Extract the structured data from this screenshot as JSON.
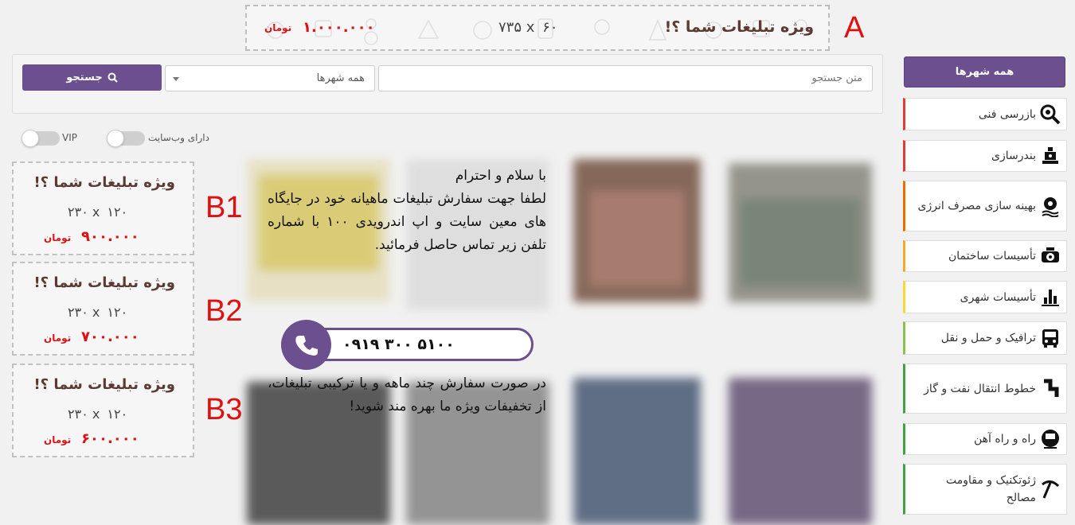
{
  "top_banner": {
    "title": "ویژه تبلیغات شما ؟!",
    "dims": "۷۳۵ x ۶۰",
    "price": "۱.۰۰۰.۰۰۰",
    "unit": "تومان",
    "marker": "A"
  },
  "search": {
    "placeholder": "متن جستجو",
    "city_value": "همه شهرها",
    "button_label": "جستجو"
  },
  "toggles": {
    "website_label": "دارای وب‌سایت",
    "vip_label": "VIP"
  },
  "sidebar": {
    "all_cities": "همه شهرها",
    "items": [
      {
        "label": "بازرسی فنی",
        "icon": "magnifier-gear-icon",
        "color": "#e53935"
      },
      {
        "label": "بندرسازی",
        "icon": "anchor-icon",
        "color": "#e53935"
      },
      {
        "label": "بهینه سازی مصرف انرژی",
        "icon": "energy-gear-icon",
        "color": "#ef6c00"
      },
      {
        "label": "تأسیسات ساختمان",
        "icon": "pump-icon",
        "color": "#f9a825"
      },
      {
        "label": "تأسیسات شهری",
        "icon": "city-tower-icon",
        "color": "#fdd835"
      },
      {
        "label": "ترافیک و حمل و نقل",
        "icon": "bus-icon",
        "color": "#8bc34a"
      },
      {
        "label": "خطوط انتقال نفت و گاز",
        "icon": "pipeline-icon",
        "color": "#43a047"
      },
      {
        "label": "راه و راه آهن",
        "icon": "train-icon",
        "color": "#43a047"
      },
      {
        "label": "ژئوتکنیک و مقاومت مصالح",
        "icon": "pickaxe-icon",
        "color": "#43a047"
      }
    ]
  },
  "side_ads": [
    {
      "title": "ویژه تبلیغات شما ؟!",
      "dims": "۲۳۰ x ۱۲۰",
      "price": "۹۰۰.۰۰۰",
      "unit": "تومان",
      "marker": "B1"
    },
    {
      "title": "ویژه تبلیغات شما ؟!",
      "dims": "۲۳۰ x ۱۲۰",
      "price": "۷۰۰.۰۰۰",
      "unit": "تومان",
      "marker": "B2"
    },
    {
      "title": "ویژه تبلیغات شما ؟!",
      "dims": "۲۳۰ x ۱۲۰",
      "price": "۶۰۰.۰۰۰",
      "unit": "تومان",
      "marker": "B3"
    }
  ],
  "message": {
    "greeting": "با سلام و احترام",
    "body": "لطفا جهت سفارش تبلیغات ماهیانه خود در جایگاه های معین سایت و اپ اندرویدی ۱۰۰ با شماره تلفن زیر تماس حاصل فرمائید.",
    "phone": "۰۹۱۹ ۳۰۰ ۵۱۰۰",
    "footer": "در صورت سفارش چند ماهه و یا ترکیبی تبلیغات، از تخفیفات ویژه ما بهره مند شوید!"
  },
  "colors": {
    "accent": "#6c4f8e",
    "price_red": "#dd1111",
    "marker_red": "#e01010"
  }
}
